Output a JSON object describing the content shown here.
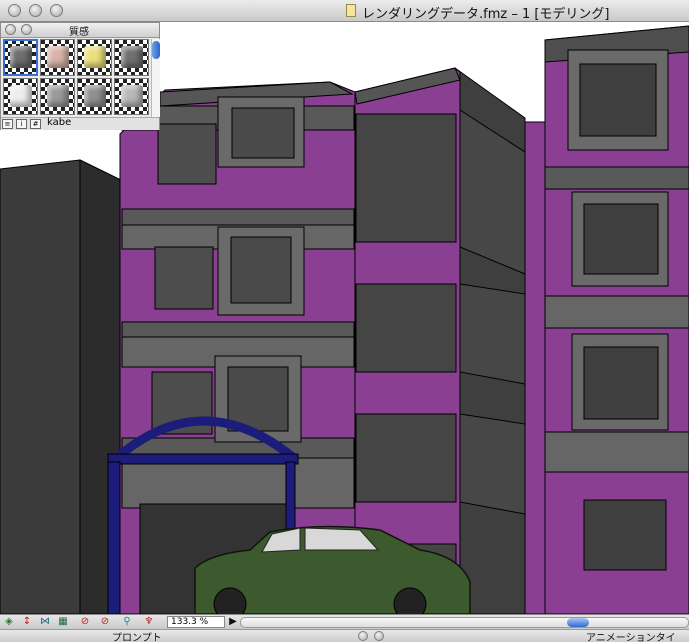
{
  "window": {
    "title": "レンダリングデータ.fmz – 1 [モデリング]"
  },
  "palette": {
    "title": "質感",
    "material_name": "kabe",
    "swatch_colors": [
      "#6e6e6e",
      "#d9b3a8",
      "#e9e07a",
      "#707070",
      "#eeeeee",
      "#9a9a9a",
      "#8f8f8f",
      "#b8b8b8"
    ],
    "selected_index": 0
  },
  "toolbar": {
    "zoom_value": "133.3 %",
    "icons": [
      "layers-icon",
      "arrow-updown-icon",
      "network-icon",
      "grid-icon",
      "prohibit-icon",
      "prohibit-alt-icon",
      "magnify-icon",
      "hand-icon",
      "play-icon"
    ]
  },
  "statusbar": {
    "prompt_label": "プロンプト",
    "timeline_label": "アニメーションタイ"
  },
  "colors": {
    "wall_purple": "#8a3f93",
    "wall_gray": "#5b5b5b",
    "arch_blue": "#1c1c7a",
    "car_green": "#3c5a2d"
  }
}
